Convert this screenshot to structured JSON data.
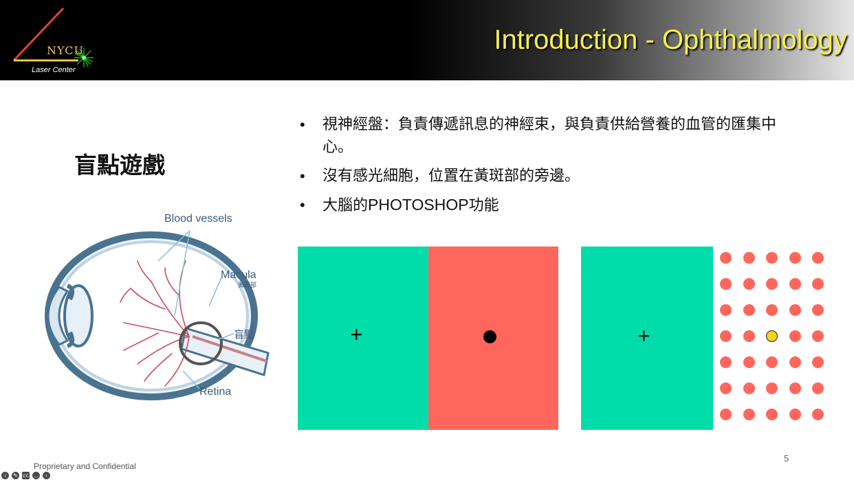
{
  "header": {
    "logo_name": "NYCU",
    "logo_sub": "Laser Center",
    "title": "Introduction - Ophthalmology",
    "colors": {
      "title": "#f7f047",
      "logo_gold": "#f2c94c",
      "logo_red": "#e0453a",
      "logo_star": "#22cc22"
    }
  },
  "section_heading": "盲點遊戲",
  "bullets": [
    {
      "text": "視神經盤：負責傳遞訊息的神經束，與負責供給營養的血管的匯集中心。"
    },
    {
      "text": "沒有感光細胞，位置在黃斑部的旁邊。"
    },
    {
      "zh_pre": "大腦的",
      "latin": "PHOTOSHOP",
      "zh_post": "功能"
    }
  ],
  "bullet_symbol": "•",
  "eye_diagram": {
    "labels": {
      "blood_vessels": "Blood vessels",
      "macula": "Macula",
      "macula_zh": "黃斑部",
      "blind_spot": "盲點",
      "retina": "Retina"
    }
  },
  "test_panels": {
    "fixation": "+",
    "colors": {
      "green": "#00ddaa",
      "red": "#ff665c",
      "yellow": "#f2d024"
    },
    "dot_grid": {
      "rows": 7,
      "cols": 5,
      "highlight": [
        3,
        2
      ]
    }
  },
  "footer": {
    "text": "Proprietary and Confidential",
    "page_number": "5"
  },
  "toolbar": {
    "icons": [
      "previous-icon",
      "pen-icon",
      "captions-icon",
      "more-icon",
      "next-icon"
    ],
    "glyphs": [
      "‹",
      "✎",
      "cc",
      "…",
      "›"
    ]
  }
}
